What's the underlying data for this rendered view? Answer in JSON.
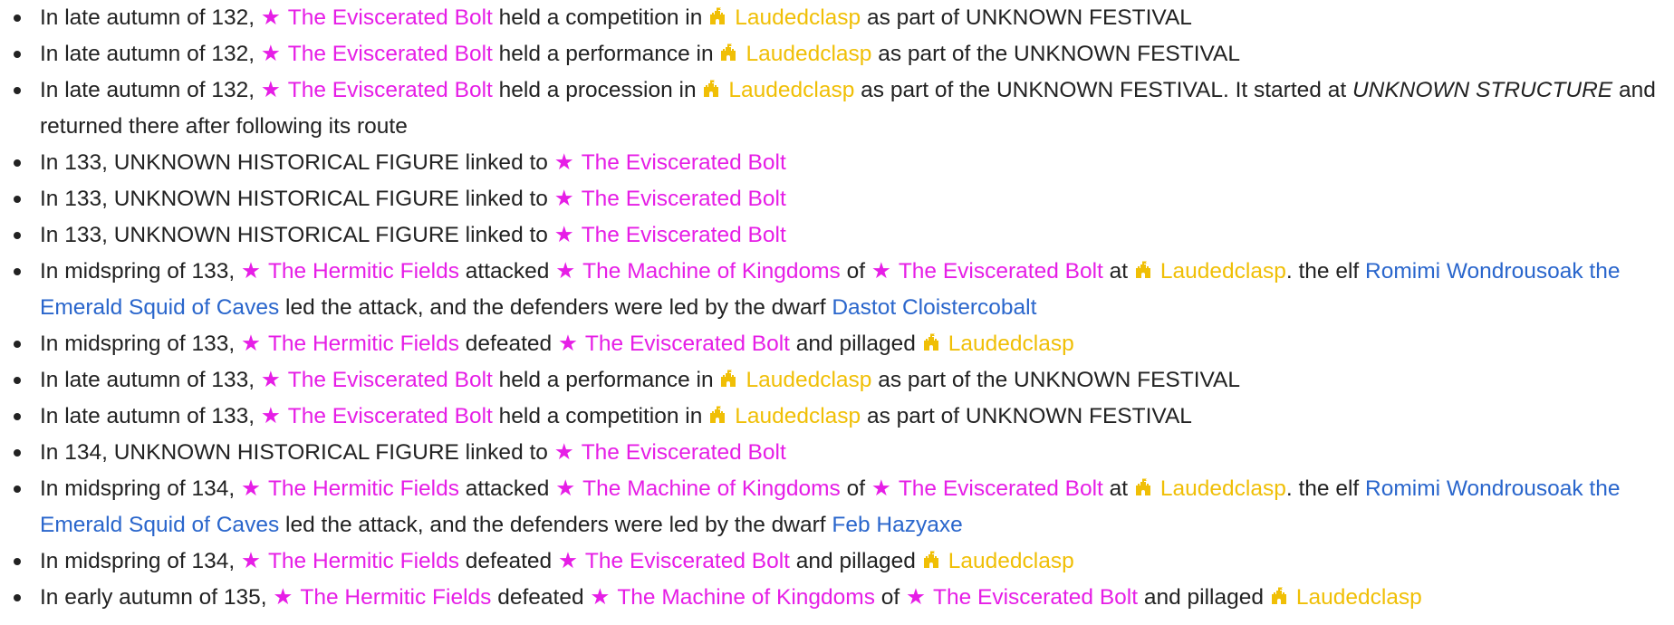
{
  "icons": {
    "entity": "star-icon",
    "site": "castle-icon"
  },
  "colors": {
    "entity": "#e61ee6",
    "site": "#f0bf06",
    "figure": "#2a66cc",
    "text": "#222222"
  },
  "events": [
    [
      {
        "t": "In late autumn of 132, "
      },
      {
        "k": "ent",
        "t": "The Eviscerated Bolt"
      },
      {
        "t": " held a competition in "
      },
      {
        "k": "site",
        "t": "Laudedclasp"
      },
      {
        "t": " as part of UNKNOWN FESTIVAL"
      }
    ],
    [
      {
        "t": "In late autumn of 132, "
      },
      {
        "k": "ent",
        "t": "The Eviscerated Bolt"
      },
      {
        "t": " held a performance in "
      },
      {
        "k": "site",
        "t": "Laudedclasp"
      },
      {
        "t": " as part of the UNKNOWN FESTIVAL"
      }
    ],
    [
      {
        "t": "In late autumn of 132, "
      },
      {
        "k": "ent",
        "t": "The Eviscerated Bolt"
      },
      {
        "t": " held a procession in "
      },
      {
        "k": "site",
        "t": "Laudedclasp"
      },
      {
        "t": " as part of the UNKNOWN FESTIVAL. It started at "
      },
      {
        "k": "unk",
        "t": "UNKNOWN STRUCTURE"
      },
      {
        "t": " and returned there after following its route"
      }
    ],
    [
      {
        "t": "In 133, UNKNOWN HISTORICAL FIGURE linked to "
      },
      {
        "k": "ent",
        "t": "The Eviscerated Bolt"
      }
    ],
    [
      {
        "t": "In 133, UNKNOWN HISTORICAL FIGURE linked to "
      },
      {
        "k": "ent",
        "t": "The Eviscerated Bolt"
      }
    ],
    [
      {
        "t": "In 133, UNKNOWN HISTORICAL FIGURE linked to "
      },
      {
        "k": "ent",
        "t": "The Eviscerated Bolt"
      }
    ],
    [
      {
        "t": "In midspring of 133, "
      },
      {
        "k": "ent",
        "t": "The Hermitic Fields"
      },
      {
        "t": " attacked "
      },
      {
        "k": "ent",
        "t": "The Machine of Kingdoms"
      },
      {
        "t": " of "
      },
      {
        "k": "ent",
        "t": "The Eviscerated Bolt"
      },
      {
        "t": " at "
      },
      {
        "k": "site",
        "t": "Laudedclasp"
      },
      {
        "t": ". the elf "
      },
      {
        "k": "hf",
        "t": "Romimi Wondrousoak the Emerald Squid of Caves"
      },
      {
        "t": " led the attack, and the defenders were led by the dwarf "
      },
      {
        "k": "hf",
        "t": "Dastot Cloistercobalt"
      }
    ],
    [
      {
        "t": "In midspring of 133, "
      },
      {
        "k": "ent",
        "t": "The Hermitic Fields"
      },
      {
        "t": " defeated "
      },
      {
        "k": "ent",
        "t": "The Eviscerated Bolt"
      },
      {
        "t": " and pillaged "
      },
      {
        "k": "site",
        "t": "Laudedclasp"
      }
    ],
    [
      {
        "t": "In late autumn of 133, "
      },
      {
        "k": "ent",
        "t": "The Eviscerated Bolt"
      },
      {
        "t": " held a performance in "
      },
      {
        "k": "site",
        "t": "Laudedclasp"
      },
      {
        "t": " as part of the UNKNOWN FESTIVAL"
      }
    ],
    [
      {
        "t": "In late autumn of 133, "
      },
      {
        "k": "ent",
        "t": "The Eviscerated Bolt"
      },
      {
        "t": " held a competition in "
      },
      {
        "k": "site",
        "t": "Laudedclasp"
      },
      {
        "t": " as part of UNKNOWN FESTIVAL"
      }
    ],
    [
      {
        "t": "In 134, UNKNOWN HISTORICAL FIGURE linked to "
      },
      {
        "k": "ent",
        "t": "The Eviscerated Bolt"
      }
    ],
    [
      {
        "t": "In midspring of 134, "
      },
      {
        "k": "ent",
        "t": "The Hermitic Fields"
      },
      {
        "t": " attacked "
      },
      {
        "k": "ent",
        "t": "The Machine of Kingdoms"
      },
      {
        "t": " of "
      },
      {
        "k": "ent",
        "t": "The Eviscerated Bolt"
      },
      {
        "t": " at "
      },
      {
        "k": "site",
        "t": "Laudedclasp"
      },
      {
        "t": ". the elf "
      },
      {
        "k": "hf",
        "t": "Romimi Wondrousoak the Emerald Squid of Caves"
      },
      {
        "t": " led the attack, and the defenders were led by the dwarf "
      },
      {
        "k": "hf",
        "t": "Feb Hazyaxe"
      }
    ],
    [
      {
        "t": "In midspring of 134, "
      },
      {
        "k": "ent",
        "t": "The Hermitic Fields"
      },
      {
        "t": " defeated "
      },
      {
        "k": "ent",
        "t": "The Eviscerated Bolt"
      },
      {
        "t": " and pillaged "
      },
      {
        "k": "site",
        "t": "Laudedclasp"
      }
    ],
    [
      {
        "t": "In early autumn of 135, "
      },
      {
        "k": "ent",
        "t": "The Hermitic Fields"
      },
      {
        "t": " defeated "
      },
      {
        "k": "ent",
        "t": "The Machine of Kingdoms"
      },
      {
        "t": " of "
      },
      {
        "k": "ent",
        "t": "The Eviscerated Bolt"
      },
      {
        "t": " and pillaged "
      },
      {
        "k": "site",
        "t": "Laudedclasp"
      }
    ]
  ]
}
